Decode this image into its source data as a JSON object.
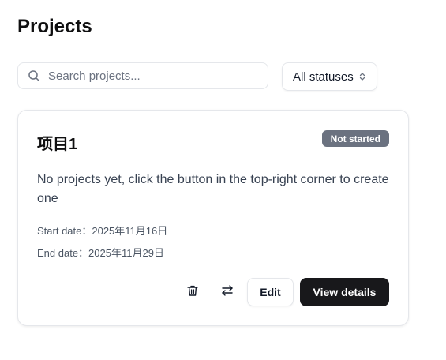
{
  "page": {
    "title": "Projects"
  },
  "toolbar": {
    "search_placeholder": "Search projects...",
    "search_value": "",
    "status_filter": "All statuses"
  },
  "project": {
    "name": "项目1",
    "status": "Not started",
    "description": "No projects yet, click the button in the top-right corner to create one",
    "start_date": "Start date：2025年11月16日",
    "end_date": "End date：2025年11月29日",
    "edit_label": "Edit",
    "view_label": "View details"
  },
  "icons": {
    "search": "search-icon",
    "select": "chevron-up-down-icon",
    "delete": "trash-icon",
    "swap": "arrows-swap-icon"
  },
  "colors": {
    "primary_button": "#18181b",
    "status_badge": "#6b7280",
    "text": "#111827",
    "border": "#e5e7eb"
  }
}
